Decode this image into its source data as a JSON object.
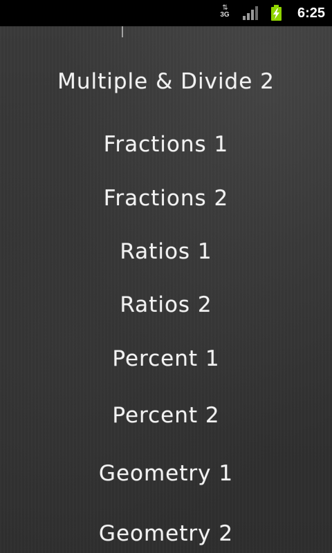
{
  "status_bar": {
    "network_type": "3G",
    "network_arrows": "⇅",
    "time": "6:25",
    "colors": {
      "battery": "#8fd400",
      "signal": "#9a9a9a"
    },
    "icons": [
      "data-activity-icon",
      "signal-strength-icon",
      "battery-charging-icon"
    ]
  },
  "menu": {
    "items": [
      {
        "label": "Multiple & Divide 2"
      },
      {
        "label": "Fractions 1"
      },
      {
        "label": "Fractions 2"
      },
      {
        "label": "Ratios 1"
      },
      {
        "label": "Ratios 2"
      },
      {
        "label": "Percent 1"
      },
      {
        "label": "Percent 2"
      },
      {
        "label": "Geometry 1"
      },
      {
        "label": "Geometry 2"
      }
    ]
  }
}
